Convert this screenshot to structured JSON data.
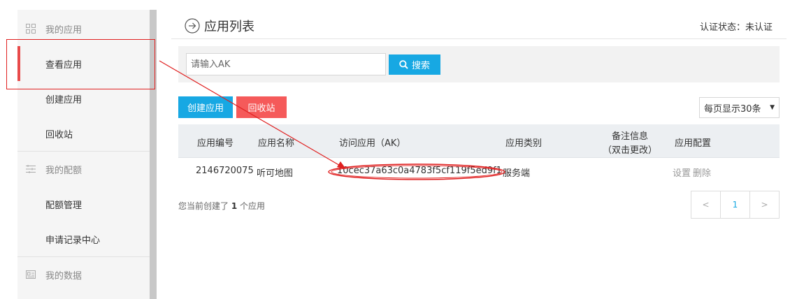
{
  "sidebar": {
    "groups": [
      {
        "label": "我的应用",
        "icon": "grid-icon"
      },
      {
        "label": "我的配额",
        "icon": "list-icon"
      },
      {
        "label": "我的数据",
        "icon": "id-card-icon"
      }
    ],
    "app_items": [
      "查看应用",
      "创建应用",
      "回收站"
    ],
    "quota_items": [
      "配额管理",
      "申请记录中心"
    ]
  },
  "header": {
    "title": "应用列表",
    "auth_status": "认证状态：未认证"
  },
  "search": {
    "placeholder": "请输入AK",
    "button_label": "搜索"
  },
  "actions": {
    "create_label": "创建应用",
    "recycle_label": "回收站",
    "page_size_label": "每页显示30条"
  },
  "table": {
    "columns": [
      "应用编号",
      "应用名称",
      "访问应用（AK）",
      "应用类别",
      "备注信息",
      "（双击更改）",
      "应用配置"
    ],
    "rows": [
      {
        "id": "2146720075",
        "name": "听可地图",
        "ak": "10cec37a63c0a4783f5cf119f5ed9f1",
        "category": "服务端",
        "settings_label": "设置",
        "delete_label": "删除"
      }
    ]
  },
  "summary": {
    "prefix": "您当前创建了",
    "count": "1",
    "suffix": "个应用"
  },
  "pagination": {
    "prev": "<",
    "current": "1",
    "next": ">"
  },
  "colors": {
    "accent": "#17a8e3",
    "danger": "#f55a5a",
    "annotation": "#e02020"
  }
}
